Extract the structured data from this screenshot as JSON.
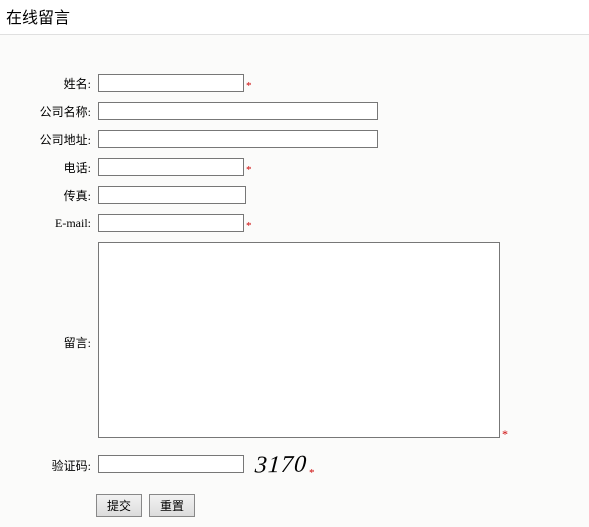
{
  "header": {
    "title": "在线留言"
  },
  "labels": {
    "name": "姓名:",
    "company": "公司名称:",
    "address": "公司地址:",
    "phone": "电话:",
    "fax": "传真:",
    "email": "E-mail:",
    "message": "留言:",
    "captcha": "验证码:"
  },
  "required_mark": "*",
  "captcha_value": "3170",
  "buttons": {
    "submit": "提交",
    "reset": "重置"
  },
  "values": {
    "name": "",
    "company": "",
    "address": "",
    "phone": "",
    "fax": "",
    "email": "",
    "message": "",
    "captcha": ""
  }
}
